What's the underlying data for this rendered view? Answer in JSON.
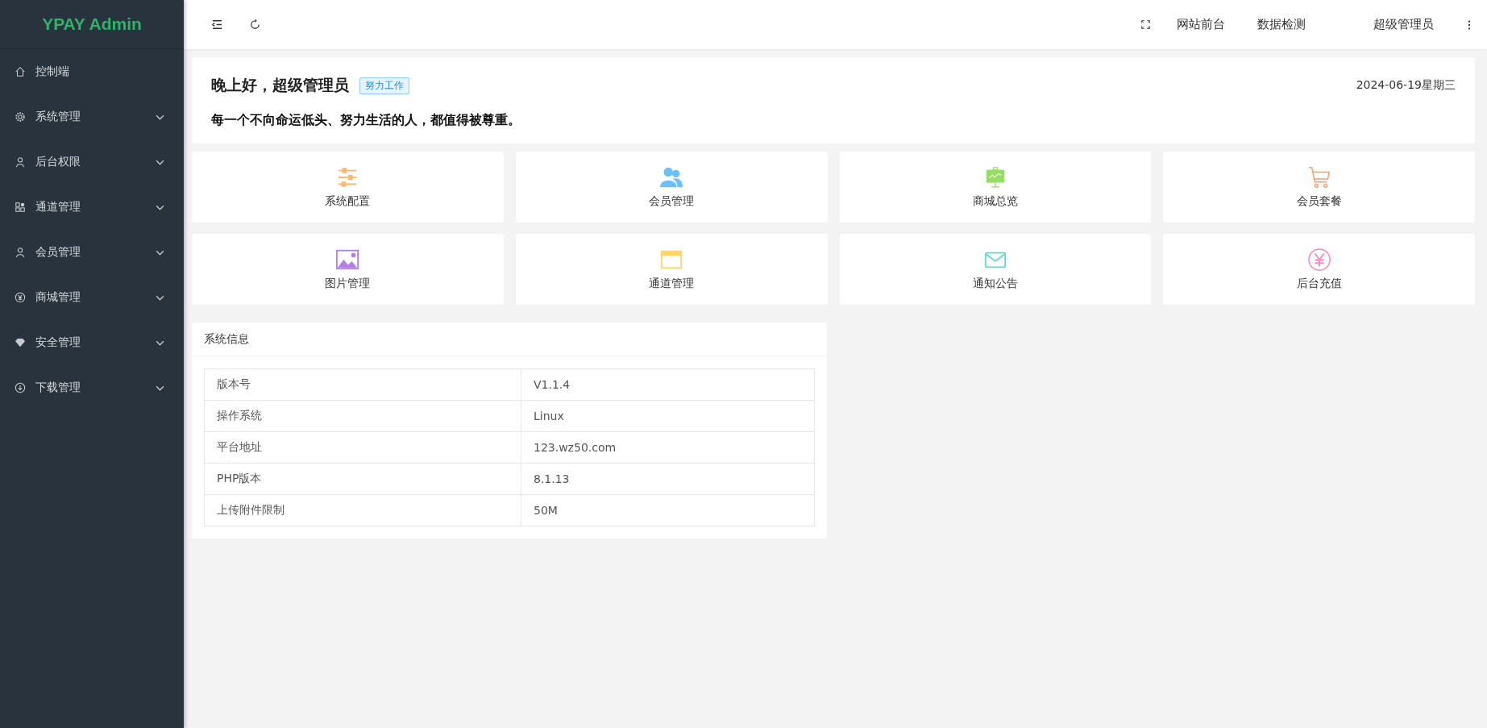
{
  "sidebar": {
    "logo": "YPAY Admin",
    "items": [
      {
        "label": "控制端",
        "kind": "home",
        "expandable": false
      },
      {
        "label": "系统管理",
        "kind": "gear",
        "expandable": true
      },
      {
        "label": "后台权限",
        "kind": "user",
        "expandable": true
      },
      {
        "label": "通道管理",
        "kind": "apps",
        "expandable": true
      },
      {
        "label": "会员管理",
        "kind": "user",
        "expandable": true
      },
      {
        "label": "商城管理",
        "kind": "yen",
        "expandable": true
      },
      {
        "label": "安全管理",
        "kind": "diamond",
        "expandable": true
      },
      {
        "label": "下载管理",
        "kind": "download",
        "expandable": true
      }
    ]
  },
  "topbar": {
    "links": [
      "网站前台",
      "数据检测"
    ],
    "user": "超级管理员"
  },
  "welcome": {
    "greeting": "晚上好，超级管理员",
    "tag": "努力工作",
    "date": "2024-06-19星期三",
    "motto": "每一个不向命运低头、努力生活的人，都值得被尊重。"
  },
  "shortcuts": [
    {
      "label": "系统配置",
      "kind": "sliders",
      "color": "#ffb86b"
    },
    {
      "label": "会员管理",
      "kind": "users",
      "color": "#69bfff"
    },
    {
      "label": "商城总览",
      "kind": "board",
      "color": "#95de64"
    },
    {
      "label": "会员套餐",
      "kind": "cart",
      "color": "#ff9c6e"
    },
    {
      "label": "图片管理",
      "kind": "image",
      "color": "#b37feb"
    },
    {
      "label": "通道管理",
      "kind": "window",
      "color": "#ffd666"
    },
    {
      "label": "通知公告",
      "kind": "mail",
      "color": "#5cdbd3"
    },
    {
      "label": "后台充值",
      "kind": "yen",
      "color": "#ff85c0"
    }
  ],
  "system_info": {
    "title": "系统信息",
    "rows": [
      {
        "label": "版本号",
        "value": "V1.1.4"
      },
      {
        "label": "操作系统",
        "value": "Linux"
      },
      {
        "label": "平台地址",
        "value": "123.wz50.com"
      },
      {
        "label": "PHP版本",
        "value": "8.1.13"
      },
      {
        "label": "上传附件限制",
        "value": "50M"
      }
    ]
  }
}
